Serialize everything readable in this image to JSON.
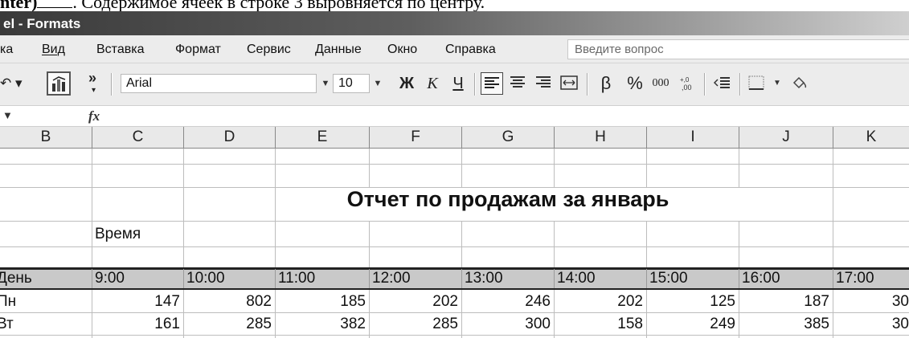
{
  "doc": {
    "strip_bold": "nter)",
    "strip_text": ". Содержимое ячеек в строке 3 выровняется по центру."
  },
  "window": {
    "title": "el - Formats"
  },
  "menu": {
    "items": [
      "ка",
      "Вид",
      "Вставка",
      "Формат",
      "Сервис",
      "Данные",
      "Окно",
      "Справка"
    ],
    "help_placeholder": "Введите вопрос"
  },
  "toolbar": {
    "undo_glyph": "↶ ▾",
    "overflow": "»",
    "font_name": "Arial",
    "font_size": "10",
    "bold": "Ж",
    "italic": "К",
    "underline": "Ч",
    "currency": "β",
    "percent": "%",
    "thousands": "000",
    "increase_decimal": "⁰⁰",
    "fill_glyph": "⌉"
  },
  "formula": {
    "fx": "fx"
  },
  "columns": [
    "B",
    "C",
    "D",
    "E",
    "F",
    "G",
    "H",
    "I",
    "J",
    "K"
  ],
  "sheet": {
    "report_title": "Отчет по продажам за январь",
    "time_label": "Время",
    "day_header": "День",
    "times": [
      "9:00",
      "10:00",
      "11:00",
      "12:00",
      "13:00",
      "14:00",
      "15:00",
      "16:00",
      "17:00"
    ],
    "rows": [
      {
        "day": "Пн",
        "values": [
          "147",
          "802",
          "185",
          "202",
          "246",
          "202",
          "125",
          "187",
          "30"
        ]
      },
      {
        "day": "Вт",
        "values": [
          "161",
          "285",
          "382",
          "285",
          "300",
          "158",
          "249",
          "385",
          "30"
        ]
      }
    ]
  }
}
